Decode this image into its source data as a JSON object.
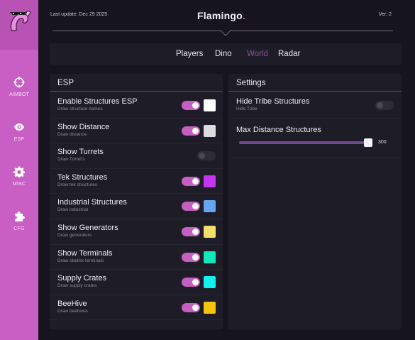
{
  "header": {
    "last_update": "Last update: Dec 29 2025",
    "brand": "Flamingo",
    "brand_dot": ".",
    "version": "Ver: 2"
  },
  "sidebar": {
    "items": [
      {
        "label": "AIMBOT",
        "icon": "crosshair-icon"
      },
      {
        "label": "ESP",
        "icon": "eye-icon"
      },
      {
        "label": "MISC",
        "icon": "gear-icon"
      },
      {
        "label": "CFG",
        "icon": "puzzle-icon"
      }
    ]
  },
  "tabs": [
    {
      "label": "Players",
      "active": false
    },
    {
      "label": "Dino",
      "active": false
    },
    {
      "label": "World",
      "active": true
    },
    {
      "label": "Radar",
      "active": false
    }
  ],
  "esp": {
    "title": "ESP",
    "rows": [
      {
        "label": "Enable Structures ESP",
        "sub": "Draw structure names",
        "enabled": true,
        "color": "#ffffff"
      },
      {
        "label": "Show Distance",
        "sub": "Draw distance",
        "enabled": true,
        "color": "#dcdcdc"
      },
      {
        "label": "Show Turrets",
        "sub": "Draw Turret's",
        "enabled": false,
        "color": null
      },
      {
        "label": "Tek Structures",
        "sub": "Draw tek structures",
        "enabled": true,
        "color": "#c434f2"
      },
      {
        "label": "Industrial Structures",
        "sub": "Draw industrial",
        "enabled": true,
        "color": "#66a6f0"
      },
      {
        "label": "Show Generators",
        "sub": "Draw generators",
        "enabled": true,
        "color": "#f6dc6a"
      },
      {
        "label": "Show Terminals",
        "sub": "Draw obelisk terminals",
        "enabled": true,
        "color": "#12e8b8"
      },
      {
        "label": "Supply Crates",
        "sub": "Draw supply crates",
        "enabled": true,
        "color": "#14f0f0"
      },
      {
        "label": "BeeHive",
        "sub": "Draw beehives",
        "enabled": true,
        "color": "#f5c40c"
      }
    ]
  },
  "settings": {
    "title": "Settings",
    "hide_tribe": {
      "label": "Hide Tribe Structures",
      "sub": "Hide Tribe",
      "enabled": false
    },
    "max_distance": {
      "label": "Max Distance Structures",
      "value": "300",
      "fraction": 0.98
    }
  },
  "colors": {
    "accent": "#c95fc4",
    "background": "#16141d",
    "panel": "#1e1c27"
  }
}
